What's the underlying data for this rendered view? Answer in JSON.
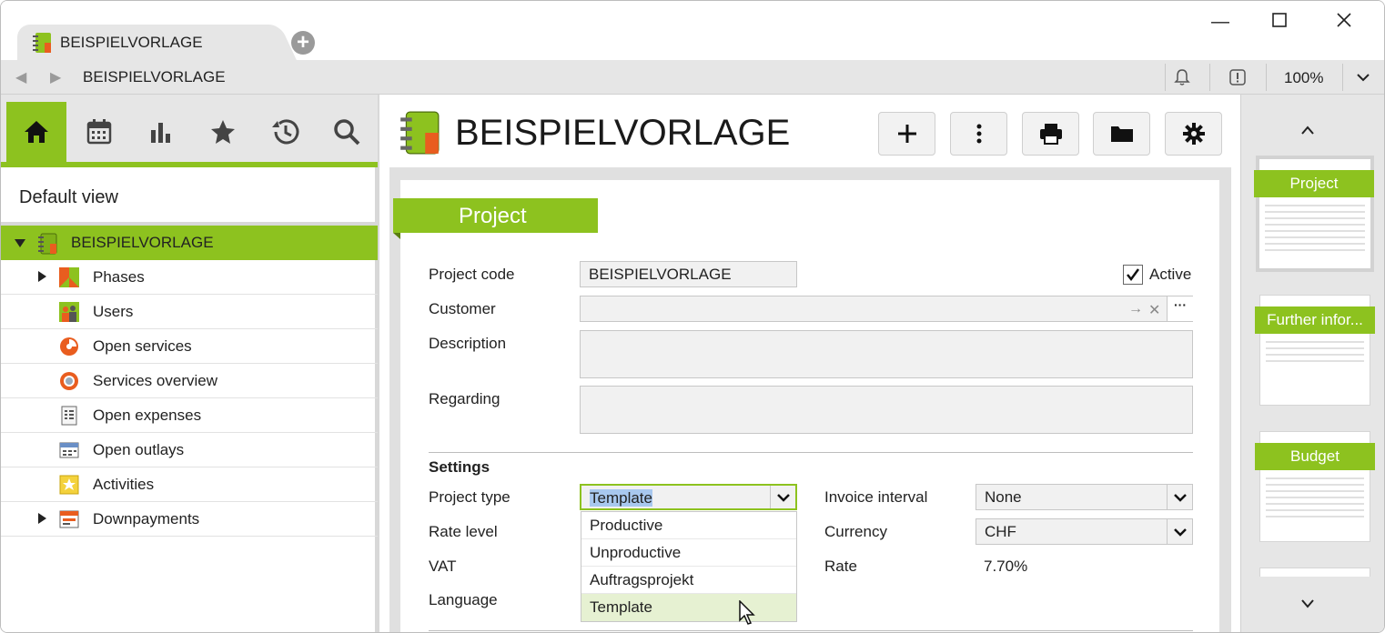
{
  "window": {
    "tab_title": "BEISPIELVORLAGE",
    "address_title": "BEISPIELVORLAGE",
    "zoom": "100%"
  },
  "left_panel": {
    "view_title": "Default view",
    "tree": [
      {
        "label": "BEISPIELVORLAGE",
        "selected": true,
        "expanded": true
      },
      {
        "label": "Phases",
        "has_children": true
      },
      {
        "label": "Users"
      },
      {
        "label": "Open services"
      },
      {
        "label": "Services overview"
      },
      {
        "label": "Open expenses"
      },
      {
        "label": "Open outlays"
      },
      {
        "label": "Activities"
      },
      {
        "label": "Downpayments",
        "has_children": true
      }
    ]
  },
  "main": {
    "title": "BEISPIELVORLAGE",
    "section": "Project",
    "fields": {
      "project_code_label": "Project code",
      "project_code_value": "BEISPIELVORLAGE",
      "active_label": "Active",
      "active_checked": true,
      "customer_label": "Customer",
      "description_label": "Description",
      "regarding_label": "Regarding"
    },
    "settings": {
      "heading": "Settings",
      "project_type_label": "Project type",
      "project_type_value": "Template",
      "rate_level_label": "Rate level",
      "vat_label": "VAT",
      "language_label": "Language",
      "invoice_interval_label": "Invoice interval",
      "invoice_interval_value": "None",
      "currency_label": "Currency",
      "currency_value": "CHF",
      "rate_label": "Rate",
      "rate_value": "7.70%"
    },
    "dropdown_options": [
      "Productive",
      "Unproductive",
      "Auftragsprojekt",
      "Template"
    ]
  },
  "right_panel": {
    "thumbnails": [
      "Project",
      "Further infor...",
      "Budget"
    ]
  },
  "colors": {
    "accent": "#8dc21f",
    "panel_bg": "#e6e6e6"
  }
}
